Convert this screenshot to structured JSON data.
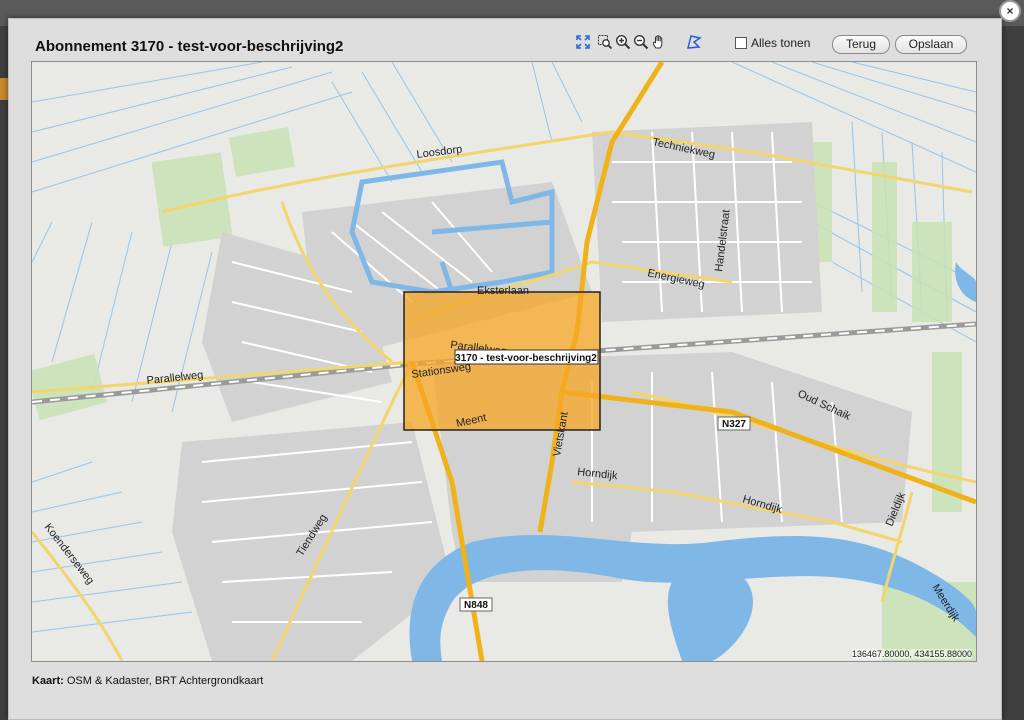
{
  "dialog": {
    "title": "Abonnement 3170 - test-voor-beschrijving2",
    "close_label": "×"
  },
  "toolbar": {
    "icons": [
      "zoom-extent-icon",
      "zoom-box-icon",
      "zoom-in-icon",
      "zoom-out-icon",
      "pan-hand-icon",
      "draw-polygon-icon"
    ],
    "show_all_label": "Alles tonen",
    "back_label": "Terug",
    "save_label": "Opslaan"
  },
  "map": {
    "area_label": "3170 - test-voor-beschrijving2",
    "area_color": "#f5a623",
    "coordinates": "136467.80000, 434155.88000",
    "street_labels": {
      "loosdorp": "Loosdorp",
      "techniekweg": "Techniekweg",
      "handelstraat": "Handelstraat",
      "energieweg": "Energieweg",
      "eksterlaan": "Eksterlaan",
      "parallelweg_left": "Parallelweg",
      "parallelweg_inner": "Parallelweg",
      "stationsweg": "Stationsweg",
      "meent": "Meent",
      "vietskant": "Vietskant",
      "n327": "N327",
      "oud_schaik": "Oud Schaik",
      "horndijk_left": "Horndijk",
      "horndijk_right": "Horndijk",
      "dieldijk": "Dieldijk",
      "koenderseweg": "Koenderseweg",
      "tiendweg": "Tiendweg",
      "n848": "N848",
      "meerdijk": "Meerdijk"
    }
  },
  "caption": {
    "bold": "Kaart:",
    "text": " OSM & Kadaster, BRT Achtergrondkaart"
  }
}
